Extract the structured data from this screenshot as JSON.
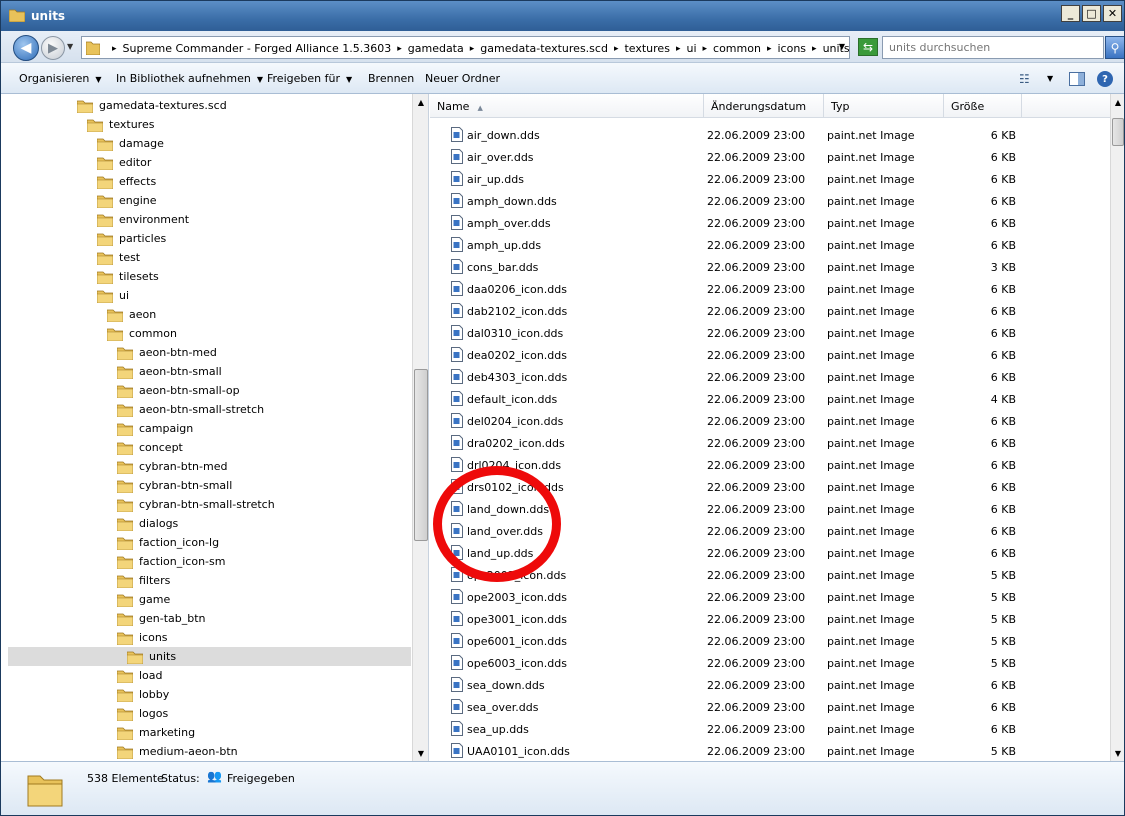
{
  "window": {
    "title": "units"
  },
  "address": {
    "crumbs": [
      "Supreme Commander - Forged Alliance 1.5.3603",
      "gamedata",
      "gamedata-textures.scd",
      "textures",
      "ui",
      "common",
      "icons",
      "units"
    ],
    "separator": "▸"
  },
  "search": {
    "placeholder": "units durchsuchen"
  },
  "toolbar": {
    "organize": "Organisieren",
    "library": "In Bibliothek aufnehmen",
    "share": "Freigeben für",
    "burn": "Brennen",
    "new_folder": "Neuer Ordner"
  },
  "tree": {
    "items": [
      {
        "label": "gamedata-textures.scd",
        "depth": 0
      },
      {
        "label": "textures",
        "depth": 1
      },
      {
        "label": "damage",
        "depth": 2
      },
      {
        "label": "editor",
        "depth": 2
      },
      {
        "label": "effects",
        "depth": 2
      },
      {
        "label": "engine",
        "depth": 2
      },
      {
        "label": "environment",
        "depth": 2
      },
      {
        "label": "particles",
        "depth": 2
      },
      {
        "label": "test",
        "depth": 2
      },
      {
        "label": "tilesets",
        "depth": 2
      },
      {
        "label": "ui",
        "depth": 2
      },
      {
        "label": "aeon",
        "depth": 3
      },
      {
        "label": "common",
        "depth": 3
      },
      {
        "label": "aeon-btn-med",
        "depth": 4
      },
      {
        "label": "aeon-btn-small",
        "depth": 4
      },
      {
        "label": "aeon-btn-small-op",
        "depth": 4
      },
      {
        "label": "aeon-btn-small-stretch",
        "depth": 4
      },
      {
        "label": "campaign",
        "depth": 4
      },
      {
        "label": "concept",
        "depth": 4
      },
      {
        "label": "cybran-btn-med",
        "depth": 4
      },
      {
        "label": "cybran-btn-small",
        "depth": 4
      },
      {
        "label": "cybran-btn-small-stretch",
        "depth": 4
      },
      {
        "label": "dialogs",
        "depth": 4
      },
      {
        "label": "faction_icon-lg",
        "depth": 4
      },
      {
        "label": "faction_icon-sm",
        "depth": 4
      },
      {
        "label": "filters",
        "depth": 4
      },
      {
        "label": "game",
        "depth": 4
      },
      {
        "label": "gen-tab_btn",
        "depth": 4
      },
      {
        "label": "icons",
        "depth": 4
      },
      {
        "label": "units",
        "depth": 5,
        "selected": true
      },
      {
        "label": "load",
        "depth": 4
      },
      {
        "label": "lobby",
        "depth": 4
      },
      {
        "label": "logos",
        "depth": 4
      },
      {
        "label": "marketing",
        "depth": 4
      },
      {
        "label": "medium-aeon-btn",
        "depth": 4
      }
    ]
  },
  "list": {
    "columns": {
      "name": "Name",
      "date": "Änderungsdatum",
      "type": "Typ",
      "size": "Größe"
    },
    "rows": [
      {
        "name": "air_down.dds",
        "date": "22.06.2009 23:00",
        "type": "paint.net Image",
        "size": "6 KB"
      },
      {
        "name": "air_over.dds",
        "date": "22.06.2009 23:00",
        "type": "paint.net Image",
        "size": "6 KB"
      },
      {
        "name": "air_up.dds",
        "date": "22.06.2009 23:00",
        "type": "paint.net Image",
        "size": "6 KB"
      },
      {
        "name": "amph_down.dds",
        "date": "22.06.2009 23:00",
        "type": "paint.net Image",
        "size": "6 KB"
      },
      {
        "name": "amph_over.dds",
        "date": "22.06.2009 23:00",
        "type": "paint.net Image",
        "size": "6 KB"
      },
      {
        "name": "amph_up.dds",
        "date": "22.06.2009 23:00",
        "type": "paint.net Image",
        "size": "6 KB"
      },
      {
        "name": "cons_bar.dds",
        "date": "22.06.2009 23:00",
        "type": "paint.net Image",
        "size": "3 KB"
      },
      {
        "name": "daa0206_icon.dds",
        "date": "22.06.2009 23:00",
        "type": "paint.net Image",
        "size": "6 KB"
      },
      {
        "name": "dab2102_icon.dds",
        "date": "22.06.2009 23:00",
        "type": "paint.net Image",
        "size": "6 KB"
      },
      {
        "name": "dal0310_icon.dds",
        "date": "22.06.2009 23:00",
        "type": "paint.net Image",
        "size": "6 KB"
      },
      {
        "name": "dea0202_icon.dds",
        "date": "22.06.2009 23:00",
        "type": "paint.net Image",
        "size": "6 KB"
      },
      {
        "name": "deb4303_icon.dds",
        "date": "22.06.2009 23:00",
        "type": "paint.net Image",
        "size": "6 KB"
      },
      {
        "name": "default_icon.dds",
        "date": "22.06.2009 23:00",
        "type": "paint.net Image",
        "size": "4 KB"
      },
      {
        "name": "del0204_icon.dds",
        "date": "22.06.2009 23:00",
        "type": "paint.net Image",
        "size": "6 KB"
      },
      {
        "name": "dra0202_icon.dds",
        "date": "22.06.2009 23:00",
        "type": "paint.net Image",
        "size": "6 KB"
      },
      {
        "name": "drl0204_icon.dds",
        "date": "22.06.2009 23:00",
        "type": "paint.net Image",
        "size": "6 KB"
      },
      {
        "name": "drs0102_icon.dds",
        "date": "22.06.2009 23:00",
        "type": "paint.net Image",
        "size": "6 KB"
      },
      {
        "name": "land_down.dds",
        "date": "22.06.2009 23:00",
        "type": "paint.net Image",
        "size": "6 KB"
      },
      {
        "name": "land_over.dds",
        "date": "22.06.2009 23:00",
        "type": "paint.net Image",
        "size": "6 KB"
      },
      {
        "name": "land_up.dds",
        "date": "22.06.2009 23:00",
        "type": "paint.net Image",
        "size": "6 KB"
      },
      {
        "name": "opc2002_icon.dds",
        "date": "22.06.2009 23:00",
        "type": "paint.net Image",
        "size": "5 KB"
      },
      {
        "name": "ope2003_icon.dds",
        "date": "22.06.2009 23:00",
        "type": "paint.net Image",
        "size": "5 KB"
      },
      {
        "name": "ope3001_icon.dds",
        "date": "22.06.2009 23:00",
        "type": "paint.net Image",
        "size": "5 KB"
      },
      {
        "name": "ope6001_icon.dds",
        "date": "22.06.2009 23:00",
        "type": "paint.net Image",
        "size": "5 KB"
      },
      {
        "name": "ope6003_icon.dds",
        "date": "22.06.2009 23:00",
        "type": "paint.net Image",
        "size": "5 KB"
      },
      {
        "name": "sea_down.dds",
        "date": "22.06.2009 23:00",
        "type": "paint.net Image",
        "size": "6 KB"
      },
      {
        "name": "sea_over.dds",
        "date": "22.06.2009 23:00",
        "type": "paint.net Image",
        "size": "6 KB"
      },
      {
        "name": "sea_up.dds",
        "date": "22.06.2009 23:00",
        "type": "paint.net Image",
        "size": "6 KB"
      },
      {
        "name": "UAA0101_icon.dds",
        "date": "22.06.2009 23:00",
        "type": "paint.net Image",
        "size": "5 KB"
      }
    ]
  },
  "status": {
    "count": "538 Elemente",
    "status_label": "Status:",
    "status_value": "Freigegeben"
  },
  "colors": {
    "folder": "#e8c25a",
    "highlight_circle": "#ee0a0a",
    "titlebar": "#3b6ea8"
  }
}
